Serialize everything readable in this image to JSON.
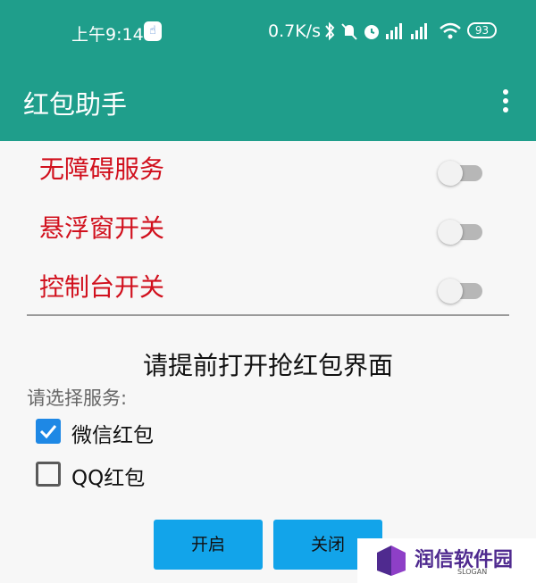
{
  "status_bar": {
    "time": "上午9:14",
    "network_speed": "0.7K/s",
    "battery": "93"
  },
  "app_bar": {
    "title": "红包助手"
  },
  "toggles": [
    {
      "label": "无障碍服务",
      "on": false
    },
    {
      "label": "悬浮窗开关",
      "on": false
    },
    {
      "label": "控制台开关",
      "on": false
    }
  ],
  "hint": "请提前打开抢红包界面",
  "service_select": {
    "label": "请选择服务:",
    "options": [
      {
        "label": "微信红包",
        "checked": true
      },
      {
        "label": "QQ红包",
        "checked": false
      }
    ]
  },
  "buttons": {
    "start": "开启",
    "stop": "关闭"
  },
  "watermark": {
    "title": "润信软件园",
    "slogan": "SLOGAN"
  },
  "colors": {
    "app_bar": "#1f9e8b",
    "toggle_label": "#d1101d",
    "button": "#12a4ea",
    "checkbox": "#1e88e5"
  }
}
